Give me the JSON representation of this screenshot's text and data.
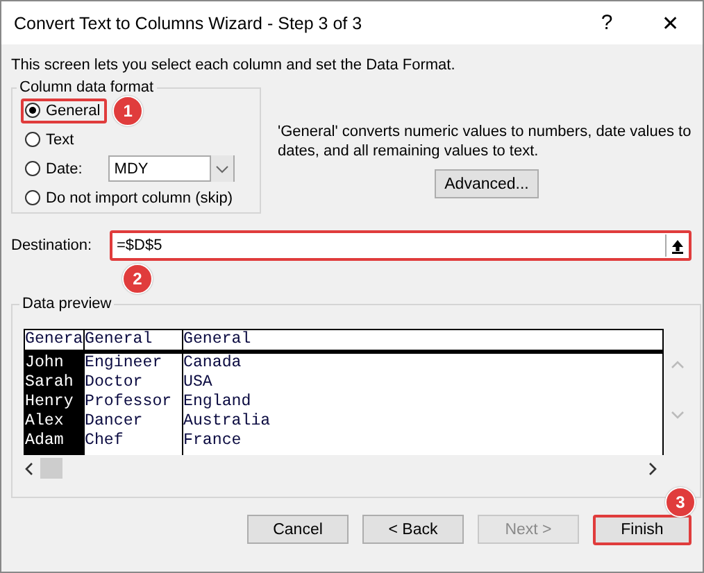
{
  "window": {
    "title": "Convert Text to Columns Wizard - Step 3 of 3",
    "help": "?",
    "close": "✕"
  },
  "intro": "This screen lets you select each column and set the Data Format.",
  "format_group": {
    "title": "Column data format",
    "options": [
      {
        "label": "General",
        "selected": true,
        "kind": "plain",
        "highlighted": true,
        "callout": "1"
      },
      {
        "label": "Text",
        "selected": false,
        "kind": "plain",
        "highlighted": false
      },
      {
        "label": "Date:",
        "selected": false,
        "kind": "date",
        "highlighted": false,
        "dropdown": "MDY"
      },
      {
        "label": "Do not import column (skip)",
        "selected": false,
        "kind": "plain",
        "highlighted": false
      }
    ]
  },
  "description": "'General' converts numeric values to numbers, date values to dates, and all remaining values to text.",
  "advanced_button": "Advanced...",
  "destination": {
    "label": "Destination:",
    "value": "=$D$5",
    "highlighted": true,
    "callout": "2"
  },
  "preview": {
    "title": "Data preview",
    "columns": [
      {
        "header": "Genera",
        "selected": true,
        "cells": [
          "John",
          "Sarah",
          "Henry",
          "Alex",
          "Adam"
        ]
      },
      {
        "header": "General",
        "selected": false,
        "cells": [
          "Engineer",
          "Doctor",
          "Professor",
          "Dancer",
          "Chef"
        ]
      },
      {
        "header": "General",
        "selected": false,
        "cells": [
          "Canada",
          "USA",
          "England",
          "Australia",
          "France"
        ]
      }
    ]
  },
  "buttons": [
    {
      "label": "Cancel",
      "disabled": false,
      "highlighted": false
    },
    {
      "label": "< Back",
      "disabled": false,
      "highlighted": false
    },
    {
      "label": "Next >",
      "disabled": true,
      "highlighted": false
    },
    {
      "label": "Finish",
      "disabled": false,
      "highlighted": true,
      "callout": "3"
    }
  ]
}
